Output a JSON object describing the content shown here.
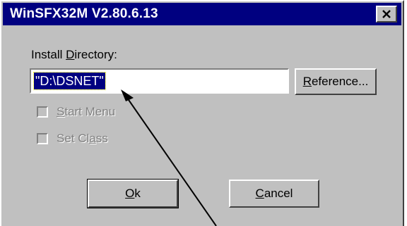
{
  "window": {
    "title": "WinSFX32M V2.80.6.13"
  },
  "form": {
    "install_label_pre": "Install ",
    "install_label_mnemonic": "D",
    "install_label_post": "irectory:",
    "directory_value": "\"D:\\DSNET\"",
    "reference_mnemonic": "R",
    "reference_rest": "eference..."
  },
  "options": {
    "start_menu_mnemonic": "S",
    "start_menu_rest": "tart Menu",
    "set_class_pre": "Set Cl",
    "set_class_mnemonic": "a",
    "set_class_post": "ss",
    "start_menu_checked": false,
    "set_class_checked": false,
    "enabled": false
  },
  "buttons": {
    "ok_mnemonic": "O",
    "ok_rest": "k",
    "cancel_mnemonic": "C",
    "cancel_rest": "ancel"
  },
  "icons": {
    "close": "close-icon"
  }
}
